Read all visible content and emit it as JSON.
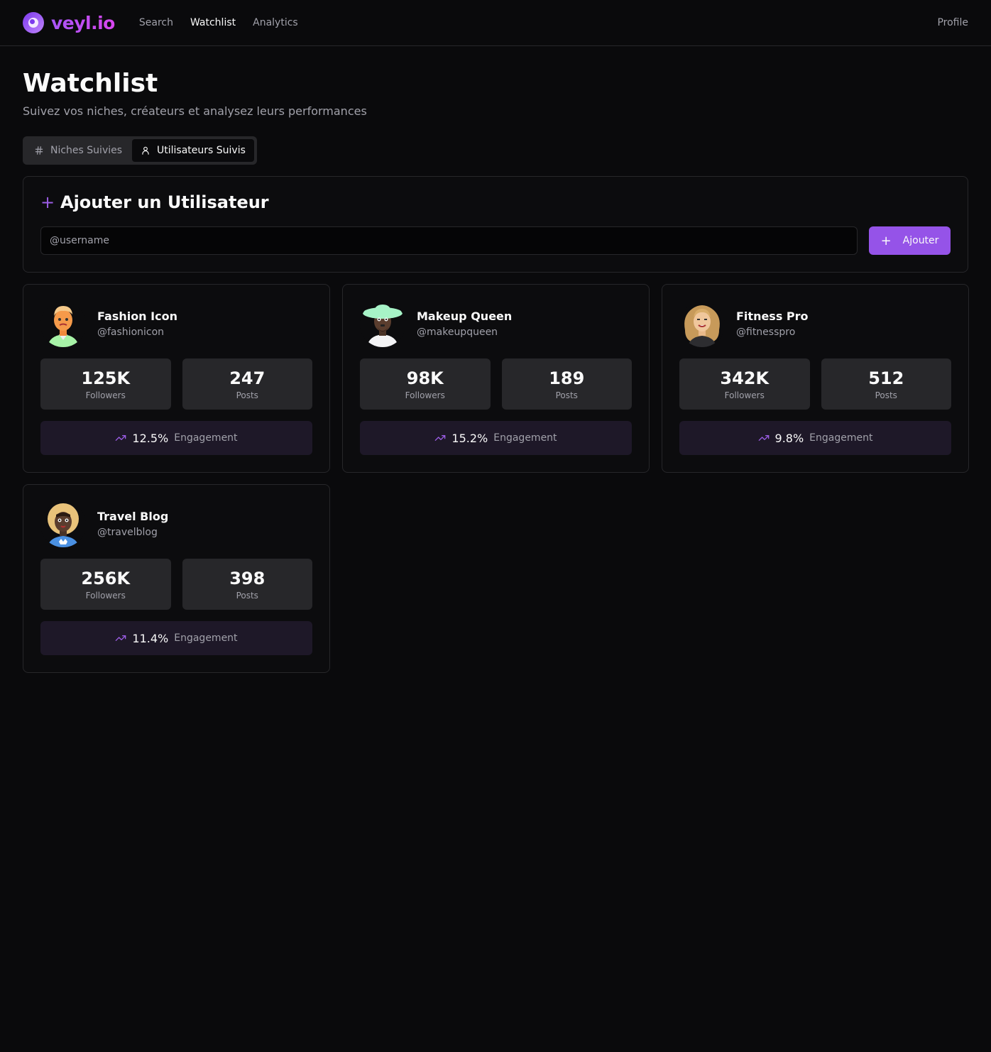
{
  "brand": {
    "name": "veyl.io"
  },
  "nav": {
    "items": [
      "Search",
      "Watchlist",
      "Analytics"
    ],
    "profile": "Profile"
  },
  "page": {
    "title": "Watchlist",
    "subtitle": "Suivez vos niches, créateurs et analysez leurs performances"
  },
  "tabs": [
    {
      "label": "Niches Suivies",
      "icon": "hash-icon"
    },
    {
      "label": "Utilisateurs Suivis",
      "icon": "user-icon"
    }
  ],
  "add_user": {
    "title": "Ajouter un Utilisateur",
    "input_placeholder": "@username",
    "input_value": "",
    "button_label": "Ajouter"
  },
  "users": [
    {
      "name": "Fashion Icon",
      "handle": "@fashionicon",
      "followers": "125K",
      "followers_label": "Followers",
      "posts": "247",
      "posts_label": "Posts",
      "engagement": "12.5%",
      "engagement_label": "Engagement"
    },
    {
      "name": "Makeup Queen",
      "handle": "@makeupqueen",
      "followers": "98K",
      "followers_label": "Followers",
      "posts": "189",
      "posts_label": "Posts",
      "engagement": "15.2%",
      "engagement_label": "Engagement"
    },
    {
      "name": "Fitness Pro",
      "handle": "@fitnesspro",
      "followers": "342K",
      "followers_label": "Followers",
      "posts": "512",
      "posts_label": "Posts",
      "engagement": "9.8%",
      "engagement_label": "Engagement"
    },
    {
      "name": "Travel Blog",
      "handle": "@travelblog",
      "followers": "256K",
      "followers_label": "Followers",
      "posts": "398",
      "posts_label": "Posts",
      "engagement": "11.4%",
      "engagement_label": "Engagement"
    }
  ],
  "colors": {
    "accent": "#9553e8",
    "background": "#0a0a0c",
    "card": "#0c0c0e",
    "stat_bg": "#27272a",
    "engagement_bg": "#1e1828"
  }
}
